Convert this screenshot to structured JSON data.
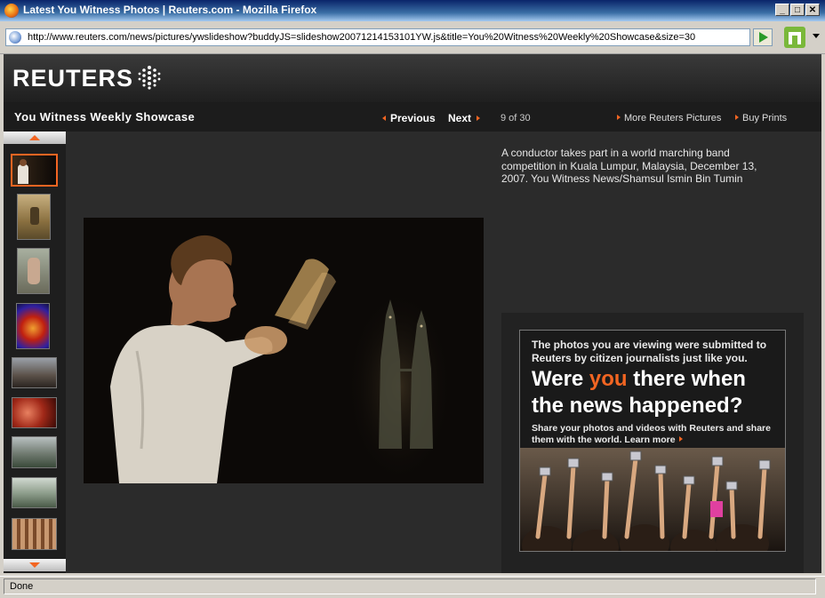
{
  "window": {
    "title": "Latest You Witness Photos | Reuters.com - Mozilla Firefox",
    "minimize": "_",
    "maximize": "□",
    "close": "✕"
  },
  "address_bar": {
    "url": "http://www.reuters.com/news/pictures/ywslideshow?buddyJS=slideshow20071214153101YW.js&title=You%20Witness%20Weekly%20Showcase&size=30"
  },
  "site": {
    "logo_text": "REUTERS",
    "slideshow_title": "You Witness Weekly Showcase",
    "previous_label": "Previous",
    "next_label": "Next",
    "counter": "9 of 30",
    "more_pictures_label": "More Reuters Pictures",
    "buy_prints_label": "Buy Prints",
    "accent_color": "#f26522"
  },
  "caption": "A conductor takes part in a world marching band competition in Kuala Lumpur, Malaysia, December 13, 2007. You Witness News/Shamsul Ismin Bin Tumin",
  "thumbnails": {
    "count": 9,
    "selected_index": 0
  },
  "ad": {
    "intro": "The photos you are viewing were submitted to Reuters by citizen journalists just like you.",
    "headline_before": "Were ",
    "headline_highlight": "you",
    "headline_after": " there when the news happened?",
    "body": "Share your photos and videos with Reuters and share them with the world.",
    "learn_more": "Learn more"
  },
  "status": {
    "text": "Done"
  }
}
